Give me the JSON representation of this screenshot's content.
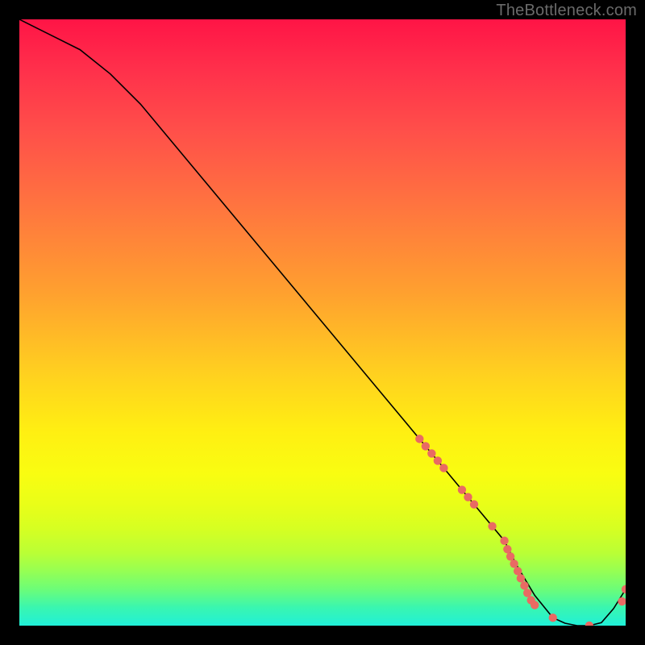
{
  "watermark": "TheBottleneck.com",
  "chart_data": {
    "type": "line",
    "title": "",
    "xlabel": "",
    "ylabel": "",
    "xlim": [
      0,
      100
    ],
    "ylim": [
      0,
      100
    ],
    "series": [
      {
        "name": "bottleneck-curve",
        "x": [
          0,
          3,
          6,
          10,
          15,
          20,
          30,
          40,
          50,
          60,
          70,
          75,
          80,
          82,
          85,
          88,
          90,
          92,
          94,
          96,
          98,
          100
        ],
        "y": [
          100,
          98.5,
          97,
          95,
          91,
          86,
          74,
          62,
          50,
          38,
          26,
          20,
          14,
          10,
          5,
          1.3,
          0.4,
          0,
          0,
          0.5,
          2.8,
          6
        ],
        "color": "#000000",
        "width": 1.6
      }
    ],
    "points": {
      "name": "highlighted-points",
      "color": "#e96a63",
      "radius": 5.2,
      "x": [
        66,
        67,
        68,
        69,
        70,
        73,
        74,
        75,
        78,
        80,
        80.5,
        81,
        81.6,
        82.2,
        82.7,
        83.3,
        83.8,
        84.4,
        85,
        88,
        94,
        99.4,
        100
      ],
      "y": [
        30.8,
        29.6,
        28.4,
        27.2,
        26,
        22.4,
        21.2,
        20,
        16.4,
        14,
        12.6,
        11.4,
        10.2,
        9.0,
        7.8,
        6.6,
        5.4,
        4.2,
        3.4,
        1.3,
        0,
        4.0,
        6
      ]
    }
  }
}
